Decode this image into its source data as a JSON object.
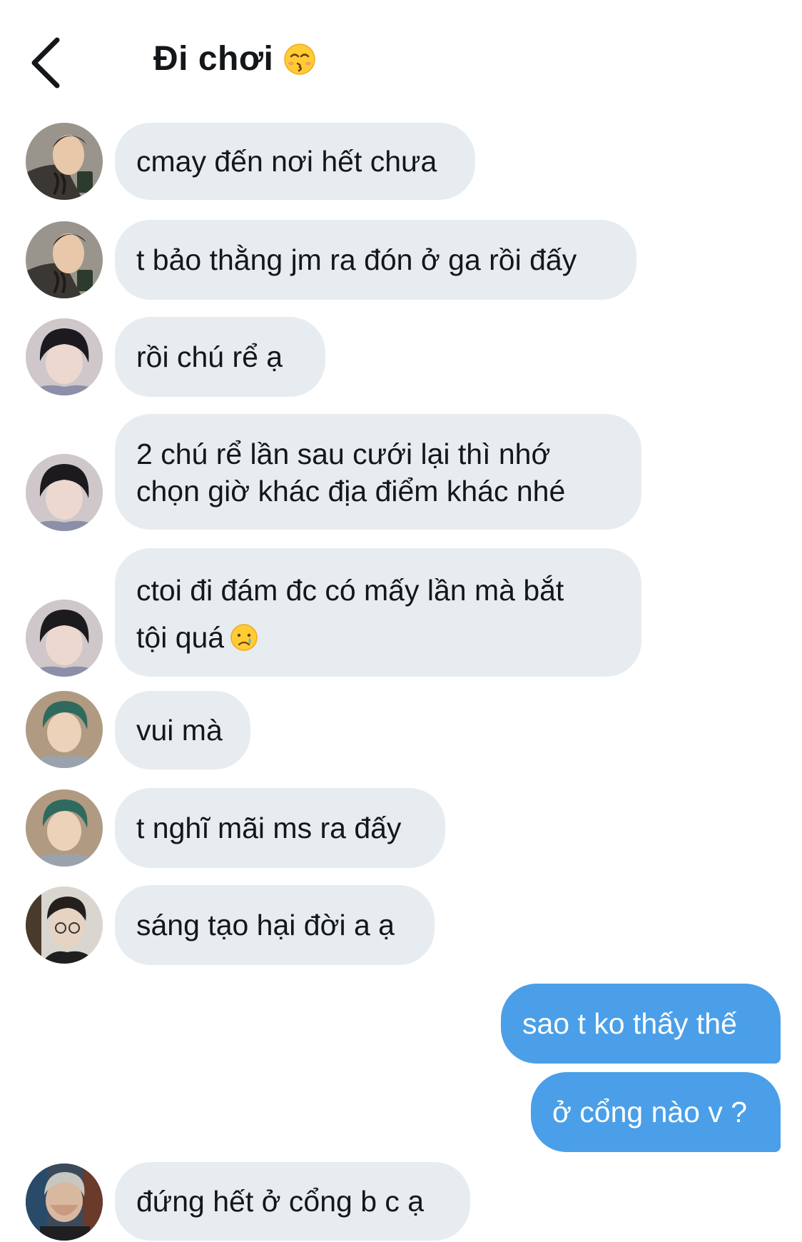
{
  "header": {
    "title": "Đi chơi",
    "title_emoji": "kissing-face-closed-eyes"
  },
  "messages": [
    {
      "direction": "in",
      "avatar": "avatar-a",
      "text": "cmay đến nơi hết chưa"
    },
    {
      "direction": "in",
      "avatar": "avatar-a",
      "text": "t bảo thằng jm ra đón ở ga rồi đấy"
    },
    {
      "direction": "in",
      "avatar": "avatar-b",
      "text": "rồi chú rể ạ"
    },
    {
      "direction": "in",
      "avatar": "avatar-b",
      "line1": "2 chú rể lần sau cưới lại thì nhớ",
      "line2": "chọn giờ khác địa điểm khác nhé"
    },
    {
      "direction": "in",
      "avatar": "avatar-b",
      "line1": "ctoi đi đám đc có mấy lần mà bắt",
      "line2": "tội quá",
      "emoji": "crying-face"
    },
    {
      "direction": "in",
      "avatar": "avatar-c",
      "text": "vui mà"
    },
    {
      "direction": "in",
      "avatar": "avatar-c",
      "text": "t nghĩ mãi ms ra đấy"
    },
    {
      "direction": "in",
      "avatar": "avatar-d",
      "text": "sáng tạo hại đời a ạ"
    },
    {
      "direction": "out",
      "text": "sao t ko thấy thế"
    },
    {
      "direction": "out",
      "text": "ở cổng nào v ?"
    },
    {
      "direction": "in",
      "avatar": "avatar-e",
      "text": "đứng hết ở cổng b c ạ"
    }
  ],
  "colors": {
    "incoming_bubble": "#e6ecf0",
    "outgoing_bubble": "#4a9fe8",
    "text": "#14171a"
  }
}
